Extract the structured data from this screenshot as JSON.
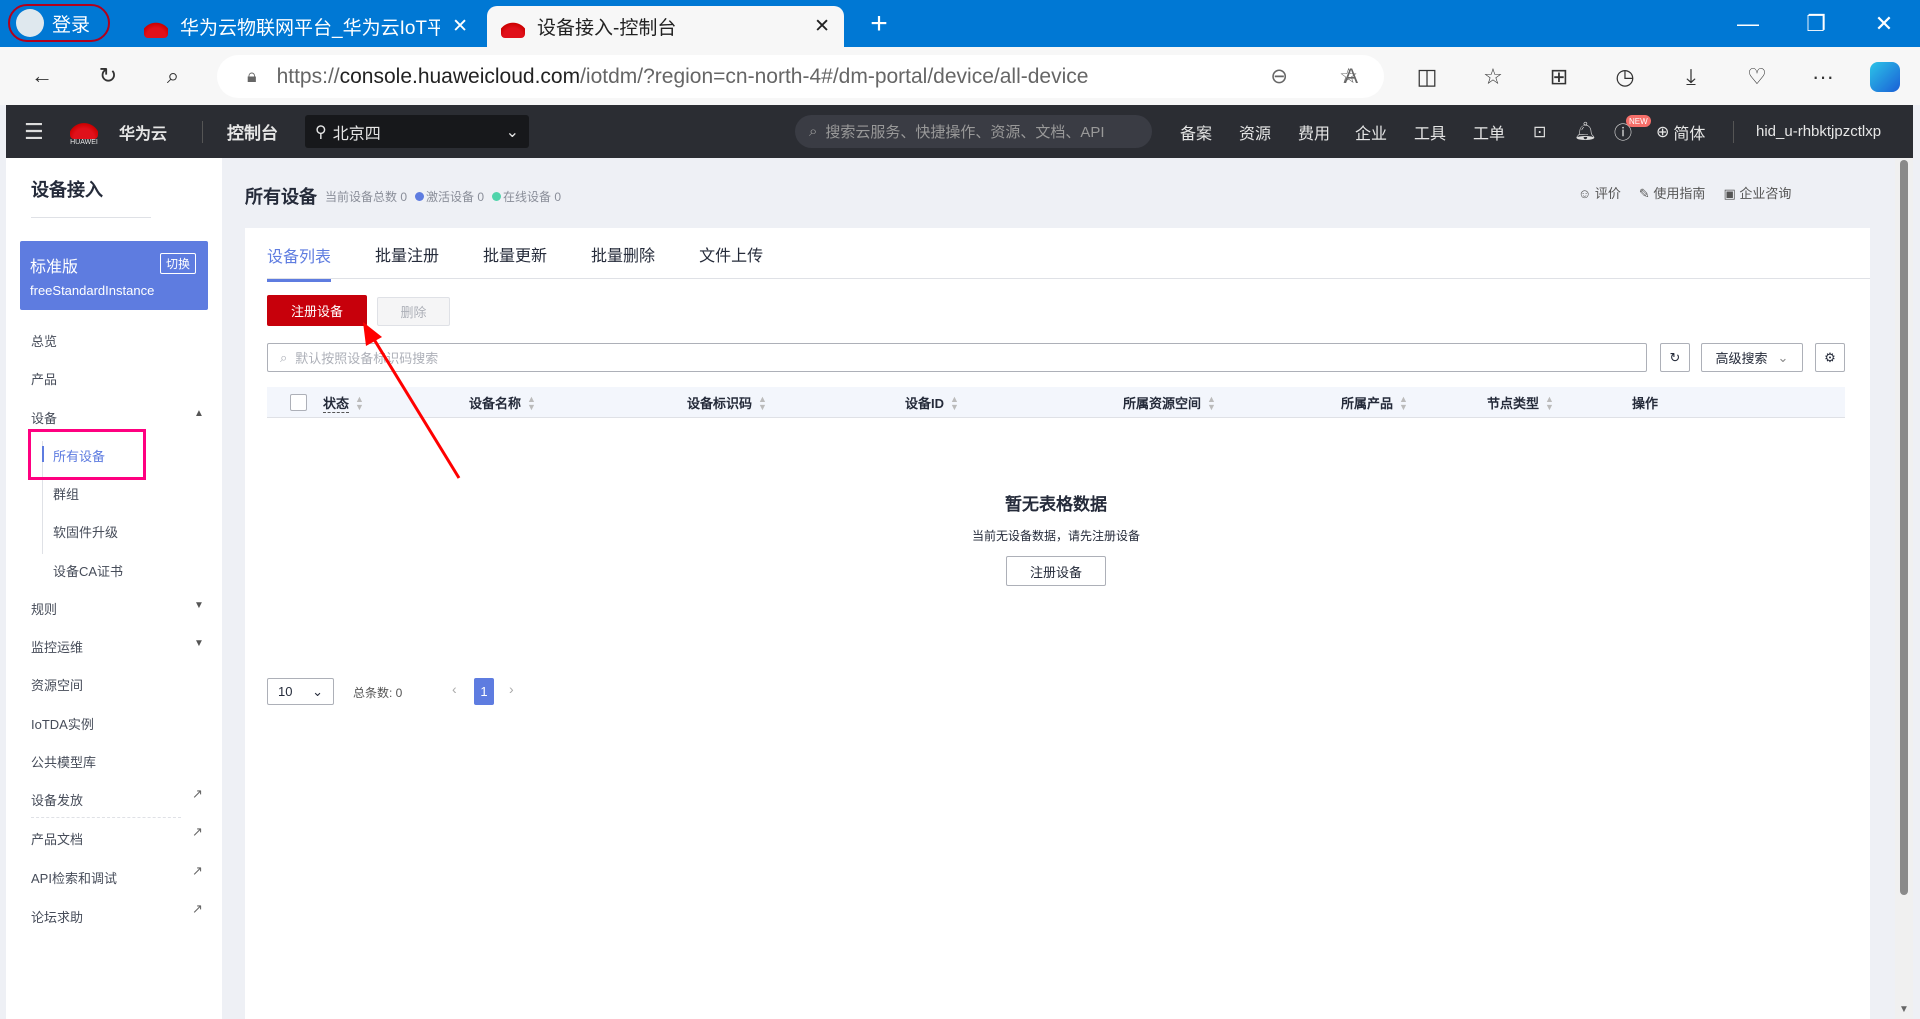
{
  "browser": {
    "profile_label": "登录",
    "tabs": [
      {
        "title": "华为云物联网平台_华为云IoT平台"
      },
      {
        "title": "设备接入-控制台",
        "active": true
      }
    ],
    "url_prefix": "https://",
    "url_host": "console.huaweicloud.com",
    "url_path": "/iotdm/?region=cn-north-4#/dm-portal/device/all-device"
  },
  "console": {
    "brand": "华为云",
    "logo_text": "HUAWEI",
    "console_label": "控制台",
    "region": "北京四",
    "search_placeholder": "搜索云服务、快捷操作、资源、文档、API",
    "nav": [
      "备案",
      "资源",
      "费用",
      "企业",
      "工具",
      "工单"
    ],
    "new_badge": "NEW",
    "language": "简体",
    "user": "hid_u-rhbktjpzctlxp"
  },
  "sidebar": {
    "title": "设备接入",
    "instance": {
      "edition": "标准版",
      "switch_label": "切换",
      "name": "freeStandardInstance"
    },
    "items": [
      "总览",
      "产品",
      "设备"
    ],
    "device_sub": [
      "所有设备",
      "群组",
      "软固件升级",
      "设备CA证书"
    ],
    "items2": [
      "规则",
      "监控运维",
      "资源空间",
      "IoTDA实例",
      "公共模型库",
      "设备发放"
    ],
    "external": [
      "产品文档",
      "API检索和调试",
      "论坛求助"
    ]
  },
  "page": {
    "title": "所有设备",
    "total_label": "当前设备总数 0",
    "active_label": "激活设备 0",
    "online_label": "在线设备 0",
    "active_color": "#5e7ce0",
    "online_color": "#50d4ab",
    "links": [
      "评价",
      "使用指南",
      "企业咨询"
    ],
    "tabs": [
      "设备列表",
      "批量注册",
      "批量更新",
      "批量删除",
      "文件上传"
    ],
    "register_button": "注册设备",
    "delete_button": "删除",
    "search_placeholder": "默认按照设备标识码搜索",
    "advanced_search": "高级搜索",
    "columns": [
      "状态",
      "设备名称",
      "设备标识码",
      "设备ID",
      "所属资源空间",
      "所属产品",
      "节点类型",
      "操作"
    ],
    "empty_title": "暂无表格数据",
    "empty_desc": "当前无设备数据，请先注册设备",
    "empty_button": "注册设备",
    "page_size": "10",
    "total_count": "总条数: 0",
    "current_page": "1"
  },
  "colors": {
    "brand_red": "#c7000b",
    "accent": "#5e7ce0",
    "highlight_box": "#ff0080"
  }
}
